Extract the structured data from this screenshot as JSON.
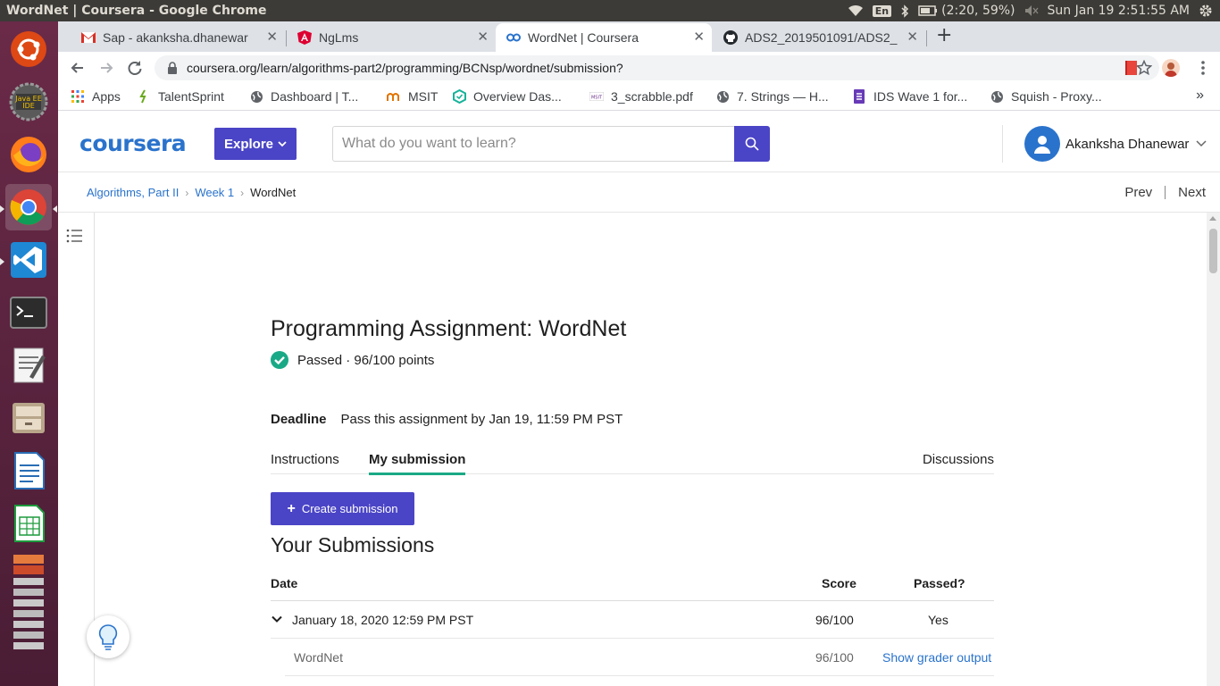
{
  "os": {
    "window_title": "WordNet | Coursera - Google Chrome",
    "keyboard_lang": "En",
    "battery": "(2:20, 59%)",
    "clock": "Sun Jan 19  2:51:55 AM"
  },
  "browser": {
    "tabs": [
      {
        "title": "Sap - akanksha.dhanewar",
        "icon": "gmail-icon"
      },
      {
        "title": "NgLms",
        "icon": "angular-icon"
      },
      {
        "title": "WordNet | Coursera",
        "icon": "coursera-icon",
        "active": true
      },
      {
        "title": "ADS2_2019501091/ADS2_",
        "icon": "github-icon"
      }
    ],
    "url": "coursera.org/learn/algorithms-part2/programming/BCNsp/wordnet/submission?",
    "bookmarks": [
      {
        "label": "Apps",
        "icon": "apps-grid-icon"
      },
      {
        "label": "TalentSprint",
        "icon": "talentsprint-icon"
      },
      {
        "label": "Dashboard | T...",
        "icon": "globe-icon"
      },
      {
        "label": "MSIT",
        "icon": "msit-icon"
      },
      {
        "label": "Overview Das...",
        "icon": "hexagon-icon"
      },
      {
        "label": "3_scrabble.pdf",
        "icon": "pdf-icon"
      },
      {
        "label": "7. Strings — H...",
        "icon": "globe-icon"
      },
      {
        "label": "IDS Wave 1 for...",
        "icon": "form-icon"
      },
      {
        "label": "Squish - Proxy...",
        "icon": "globe-icon"
      }
    ]
  },
  "coursera": {
    "logo": "coursera",
    "explore_label": "Explore",
    "search_placeholder": "What do you want to learn?",
    "user_name": "Akanksha Dhanewar",
    "breadcrumb": [
      "Algorithms, Part II",
      "Week 1",
      "WordNet"
    ],
    "prev_label": "Prev",
    "next_label": "Next"
  },
  "assignment": {
    "title": "Programming Assignment: WordNet",
    "status": "Passed · 96/100 points",
    "deadline_label": "Deadline",
    "deadline_text": "Pass this assignment by Jan 19, 11:59 PM PST",
    "tabs": [
      "Instructions",
      "My submission",
      "Discussions"
    ],
    "create_label": "Create submission",
    "submissions_title": "Your Submissions",
    "columns": {
      "date": "Date",
      "score": "Score",
      "passed": "Passed?"
    },
    "submission": {
      "date": "January 18, 2020 12:59 PM PST",
      "score": "96/100",
      "passed": "Yes",
      "part_name": "WordNet",
      "part_score": "96/100",
      "grader_link": "Show grader output"
    }
  },
  "colors": {
    "brand": "#2a73cc",
    "primary_button": "#4a44c6",
    "success": "#1aa986"
  }
}
